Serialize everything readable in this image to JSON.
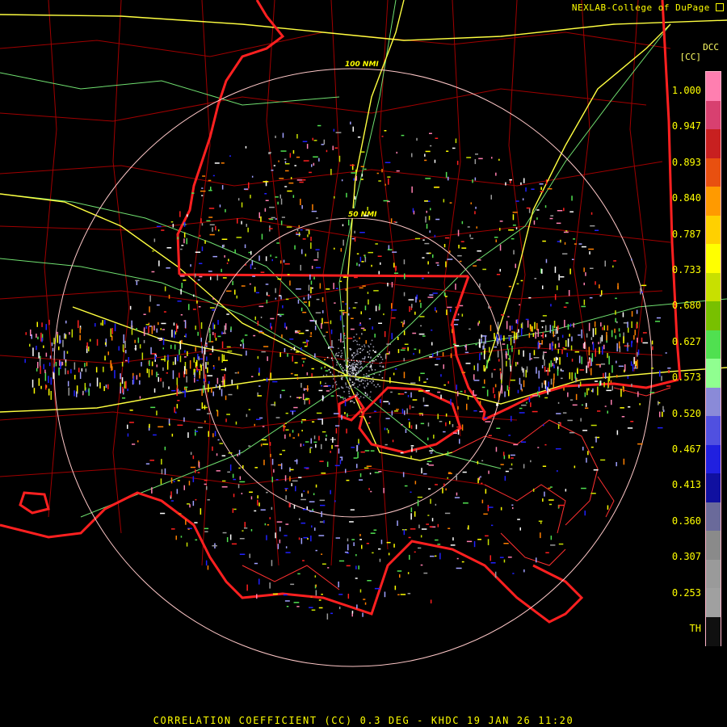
{
  "header": {
    "credit": "NEXLAB-College of DuPage"
  },
  "legend": {
    "product": "DCC",
    "unit": "[CC]",
    "ticks": [
      "1.000",
      "0.947",
      "0.893",
      "0.840",
      "0.787",
      "0.733",
      "0.680",
      "0.627",
      "0.573",
      "0.520",
      "0.467",
      "0.413",
      "0.360",
      "0.307",
      "0.253",
      "TH"
    ],
    "colors": [
      "#ff7fb0",
      "#d84070",
      "#c82020",
      "#e85010",
      "#ff9a00",
      "#ffd000",
      "#ffff00",
      "#c8e000",
      "#78c000",
      "#50e050",
      "#90ff90",
      "#8a8ad8",
      "#5050e0",
      "#2020e0",
      "#1010a0",
      "#6a6a9a",
      "#8a8a8a",
      "#9a9a9a",
      "#a0a0a0",
      "#101010"
    ]
  },
  "rings": [
    {
      "label": "100 NMI"
    },
    {
      "label": "50 NMI"
    }
  ],
  "footer": {
    "caption": "CORRELATION COEFFICIENT (CC) 0.3 DEG - KHDC 19 JAN 26 11:20"
  },
  "icons": {
    "corner": "arrow-corner-icon"
  },
  "colors": {
    "state_border": "#ff2020",
    "county_border": "#a00000",
    "highway": "#ffff40",
    "road": "#80ff80",
    "ring": "#ffc8c8",
    "text": "#ffff00"
  }
}
